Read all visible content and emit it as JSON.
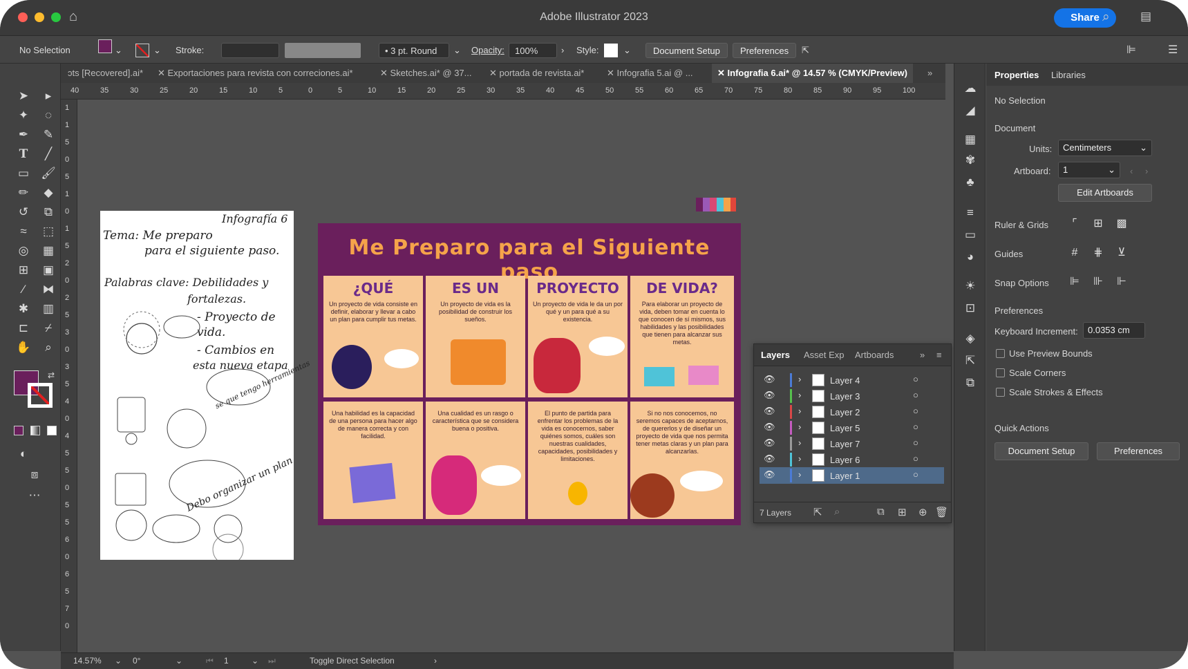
{
  "window": {
    "title": "Adobe Illustrator 2023",
    "share_label": "Share",
    "traffic": {
      "close": "#ff5f57",
      "min": "#febc2e",
      "max": "#28c840"
    }
  },
  "control_bar": {
    "selection": "No Selection",
    "stroke_label": "Stroke:",
    "brush": "3 pt. Round",
    "opacity_label": "Opacity:",
    "opacity_value": "100%",
    "style_label": "Style:",
    "document_setup": "Document Setup",
    "preferences": "Preferences",
    "fill_color": "#6a1f5c"
  },
  "tabs": [
    {
      "label": "ɔts [Recovered].ai*"
    },
    {
      "label": "Exportaciones para revista con correciones.ai*"
    },
    {
      "label": "Sketches.ai* @ 37..."
    },
    {
      "label": "portada de revista.ai*"
    },
    {
      "label": "Infografia 5.ai @ ..."
    },
    {
      "label": "Infografia 6.ai* @ 14.57 % (CMYK/Preview)"
    }
  ],
  "ruler_h": [
    "40",
    "35",
    "30",
    "25",
    "20",
    "15",
    "10",
    "5",
    "0",
    "5",
    "10",
    "15",
    "20",
    "25",
    "30",
    "35",
    "40",
    "45",
    "50",
    "55",
    "60",
    "65",
    "70",
    "75",
    "80",
    "85",
    "90",
    "95",
    "100"
  ],
  "ruler_v": [
    "1",
    "1",
    "5",
    "0",
    "5",
    "1",
    "0",
    "1",
    "5",
    "2",
    "0",
    "2",
    "5",
    "3",
    "0",
    "3",
    "5",
    "4",
    "0",
    "4",
    "5",
    "5",
    "0",
    "5",
    "5",
    "6",
    "0",
    "6",
    "5",
    "7",
    "0"
  ],
  "sketch": {
    "tag": "Infografía 6",
    "line1": "Tema: Me preparo",
    "line2": "para el siguiente paso.",
    "line3": "Palabras clave: Debilidades y",
    "line4": "fortalezas.",
    "line5": "- Proyecto de",
    "line6": "vida.",
    "line7": "- Cambios en",
    "line8": "esta nueva etapa",
    "bubble1": "Debo organizar un plan",
    "bubble2": "se que tengo herramientas"
  },
  "infographic": {
    "title": "Me Preparo para el Siguiente paso",
    "headings": [
      "¿QUÉ",
      "ES UN",
      "PROYECTO",
      "DE VIDA?"
    ],
    "top_texts": [
      "Un proyecto de vida consiste en definir, elaborar y llevar a cabo un plan para cumplir tus metas.",
      "Un proyecto de vida es la posibilidad de construir los sueños.",
      "Un proyecto de vida le da un por qué y un para qué a su existencia.",
      "Para elaborar un proyecto de vida, deben tomar en cuenta lo que conocen de sí mismos, sus habilidades y las posibilidades que tienen para alcanzar sus metas."
    ],
    "bottom_texts": [
      "Una habilidad es la capacidad de una persona para hacer algo de manera correcta y con facilidad.",
      "Una cualidad es un rasgo o característica que se considera buena o positiva.",
      "El punto de partida para enfrentar los problemas de la vida es conocernos, saber quiénes somos, cuáles son nuestras cualidades, capacidades, posibilidades y limitaciones.",
      "Si no nos conocemos, no seremos capaces de aceptarnos, de quererlos y de diseñar un proyecto de vida que nos permita tener metas claras y un plan para alcanzarlas."
    ],
    "colors": {
      "bg": "#6a1f5c",
      "cell": "#f7c795",
      "title": "#f5a34a"
    }
  },
  "layers_panel": {
    "tabs": [
      "Layers",
      "Asset Exp",
      "Artboards"
    ],
    "layers": [
      {
        "name": "Layer 4",
        "color": "#4b7bd6"
      },
      {
        "name": "Layer 3",
        "color": "#56c04d"
      },
      {
        "name": "Layer 2",
        "color": "#d94848"
      },
      {
        "name": "Layer 5",
        "color": "#c45bc0"
      },
      {
        "name": "Layer 7",
        "color": "#9a9a9a"
      },
      {
        "name": "Layer 6",
        "color": "#4fc3d8"
      },
      {
        "name": "Layer 1",
        "color": "#4b7bd6"
      }
    ],
    "count": "7 Layers"
  },
  "properties": {
    "tabs": [
      "Properties",
      "Libraries"
    ],
    "selection": "No Selection",
    "document": "Document",
    "units_label": "Units:",
    "units_value": "Centimeters",
    "artboard_label": "Artboard:",
    "artboard_value": "1",
    "edit_artboards": "Edit Artboards",
    "ruler_grids": "Ruler & Grids",
    "guides": "Guides",
    "snap": "Snap Options",
    "preferences": "Preferences",
    "keyboard_label": "Keyboard Increment:",
    "keyboard_value": "0.0353 cm",
    "use_preview": "Use Preview Bounds",
    "scale_corners": "Scale Corners",
    "scale_strokes": "Scale Strokes & Effects",
    "quick_actions": "Quick Actions",
    "doc_setup": "Document Setup",
    "prefs_btn": "Preferences"
  },
  "status": {
    "zoom": "14.57%",
    "angle": "0°",
    "artboard": "1",
    "tool": "Toggle Direct Selection"
  }
}
